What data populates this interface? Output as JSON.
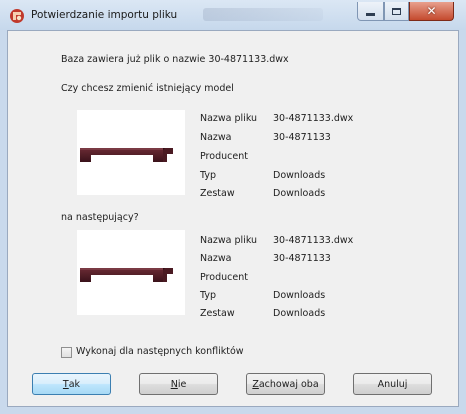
{
  "window": {
    "title": "Potwierdzanie importu pliku"
  },
  "message": {
    "line1": "Baza zawiera już plik o nazwie 30-4871133.dwx",
    "line2": "Czy chcesz zmienić istniejący model",
    "line3": "na następujący?"
  },
  "existing_model": {
    "labels": [
      "Nazwa pliku",
      "Nazwa",
      "Producent",
      "Typ",
      "Zestaw"
    ],
    "values": [
      "30-4871133.dwx",
      "30-4871133",
      "",
      "Downloads",
      "Downloads"
    ]
  },
  "new_model": {
    "labels": [
      "Nazwa pliku",
      "Nazwa",
      "Producent",
      "Typ",
      "Zestaw"
    ],
    "values": [
      "30-4871133.dwx",
      "30-4871133",
      "",
      "Downloads",
      "Downloads"
    ]
  },
  "options": {
    "apply_to_next_label": "Wykonaj dla następnych konfliktów",
    "apply_to_next_checked": false
  },
  "buttons": {
    "yes": {
      "mnemonic": "T",
      "rest": "ak"
    },
    "no": {
      "mnemonic": "N",
      "rest": "ie"
    },
    "keep_both": {
      "mnemonic": "Z",
      "rest": "achowaj oba"
    },
    "cancel": "Anuluj"
  },
  "colors": {
    "model_color": "#4a1a22",
    "default_button_border": "#3c7fb1",
    "close_button": "#c44a2e"
  },
  "icons": {
    "app": "app-logo-icon",
    "minimize": "minimize-icon",
    "maximize": "maximize-icon",
    "close": "close-icon"
  }
}
